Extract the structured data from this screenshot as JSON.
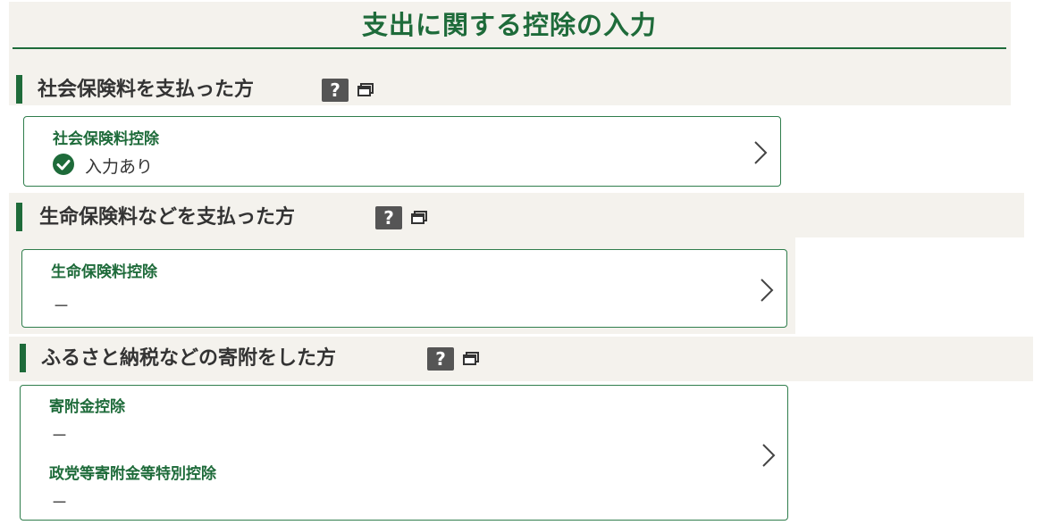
{
  "page": {
    "title": "支出に関する控除の入力"
  },
  "sections": [
    {
      "heading": "社会保険料を支払った方",
      "help_label": "?",
      "items": [
        {
          "title": "社会保険料控除",
          "value": "入力あり",
          "status": "entered"
        }
      ]
    },
    {
      "heading": "生命保険料などを支払った方",
      "help_label": "?",
      "items": [
        {
          "title": "生命保険料控除",
          "value": "－"
        }
      ]
    },
    {
      "heading": "ふるさと納税などの寄附をした方",
      "help_label": "?",
      "items": [
        {
          "title": "寄附金控除",
          "value": "－"
        },
        {
          "title": "政党等寄附金等特別控除",
          "value": "－"
        }
      ]
    }
  ],
  "colors": {
    "accent": "#1e6b3a",
    "card_border": "#2f7d4c",
    "band": "#f4f2ed",
    "check": "#1e6b3a"
  },
  "icons": {
    "help": "question-mark-icon",
    "window": "new-window-icon",
    "check": "check-circle-icon",
    "chevron": "chevron-right-icon"
  }
}
